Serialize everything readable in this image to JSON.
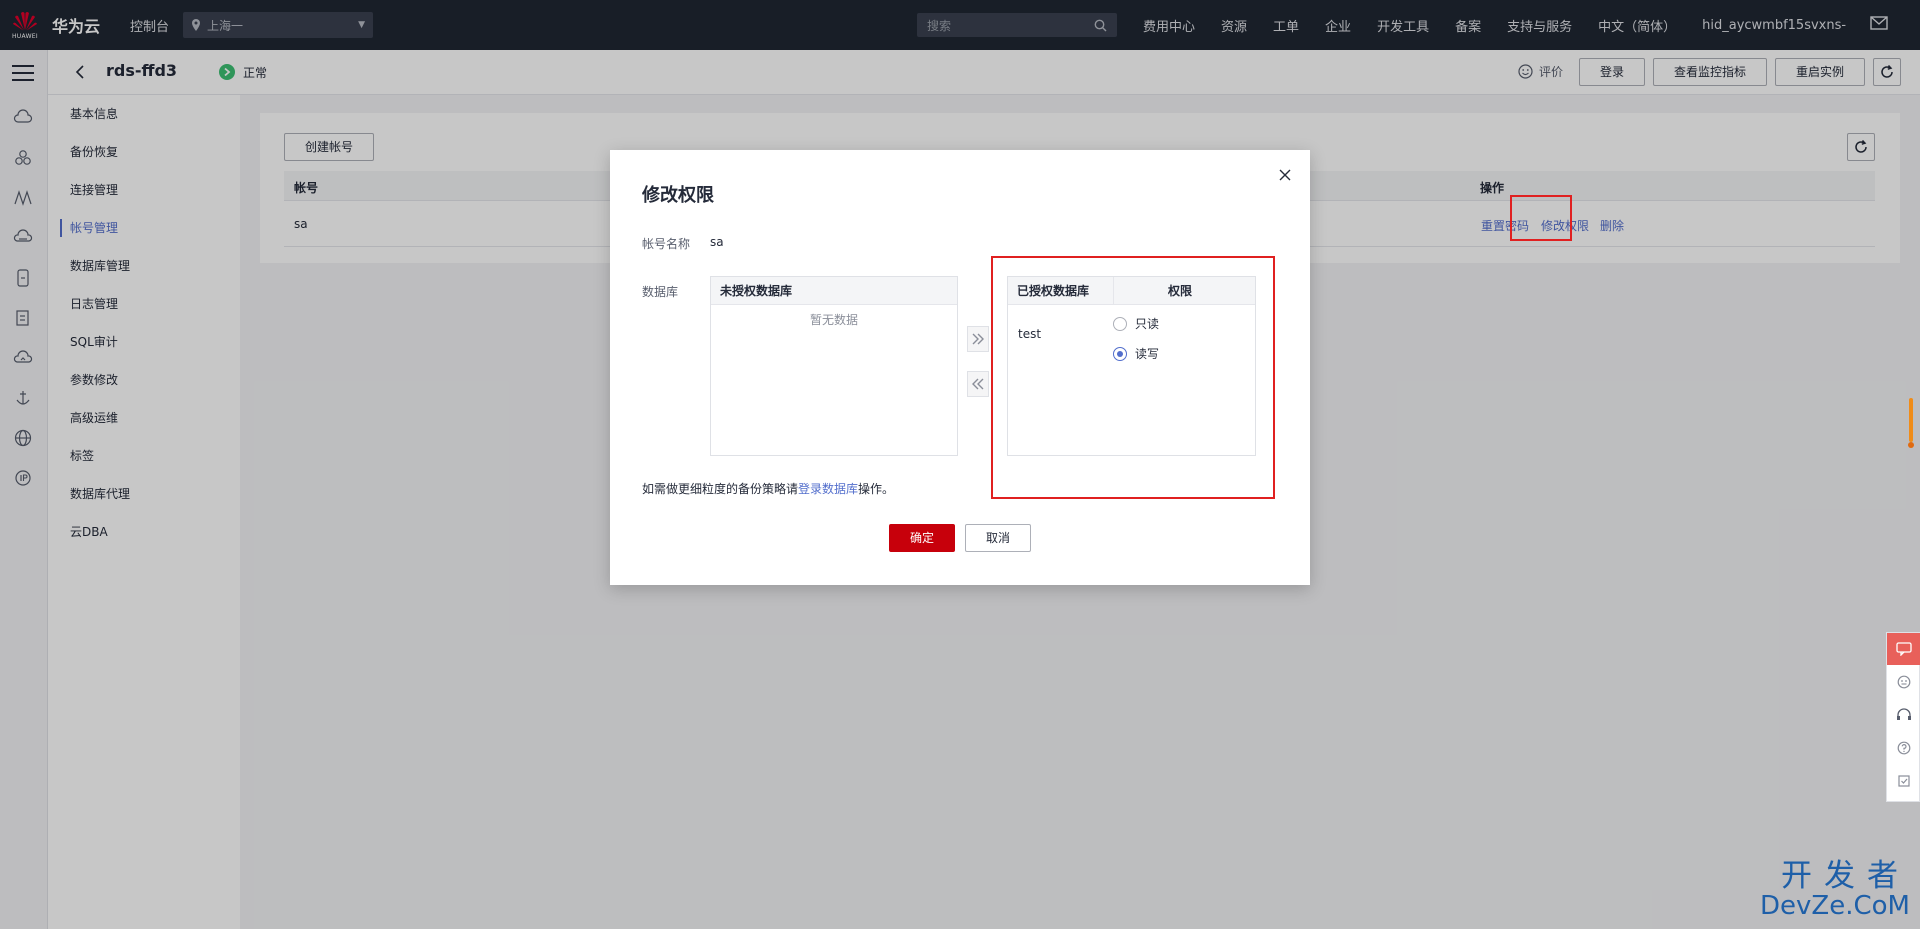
{
  "topbar": {
    "logo_sub": "HUAWEI",
    "brand": "华为云",
    "console": "控制台",
    "region": "上海一",
    "search_placeholder": "搜索",
    "nav": [
      "费用中心",
      "资源",
      "工单",
      "企业",
      "开发工具",
      "备案",
      "支持与服务",
      "中文（简体）",
      "hid_aycwmbf15svxns-"
    ]
  },
  "header": {
    "instance_name": "rds-ffd3",
    "status": "正常",
    "rate_label": "评价",
    "login_label": "登录",
    "metrics_label": "查看监控指标",
    "restart_label": "重启实例"
  },
  "subnav": {
    "items": [
      {
        "label": "基本信息"
      },
      {
        "label": "备份恢复"
      },
      {
        "label": "连接管理"
      },
      {
        "label": "帐号管理"
      },
      {
        "label": "数据库管理"
      },
      {
        "label": "日志管理"
      },
      {
        "label": "SQL审计"
      },
      {
        "label": "参数修改"
      },
      {
        "label": "高级运维"
      },
      {
        "label": "标签"
      },
      {
        "label": "数据库代理"
      },
      {
        "label": "云DBA"
      }
    ],
    "active": "帐号管理"
  },
  "accounts": {
    "create_label": "创建帐号",
    "col_account": "帐号",
    "col_actions": "操作",
    "rows": [
      {
        "name": "sa",
        "reset_pwd": "重置密码",
        "modify_perm": "修改权限",
        "delete": "删除"
      }
    ]
  },
  "dialog": {
    "title": "修改权限",
    "account_label": "帐号名称",
    "account_value": "sa",
    "db_label": "数据库",
    "unauth_header": "未授权数据库",
    "unauth_empty": "暂无数据",
    "auth_header": "已授权数据库",
    "perm_header": "权限",
    "auth_db": "test",
    "opt_readonly": "只读",
    "opt_readwrite": "读写",
    "selected_perm": "读写",
    "note_prefix": "如需做更细粒度的备份策略请",
    "note_link": "登录数据库",
    "note_suffix": "操作。",
    "ok_label": "确定",
    "cancel_label": "取消"
  },
  "watermark": {
    "top": "开发者",
    "bottom": "DevZe.CoM"
  },
  "colors": {
    "topbar": "#1f2733",
    "link": "#526ecc",
    "primary_btn": "#c7000b",
    "annotation": "#e02020",
    "status_ok": "#3dbf73"
  }
}
